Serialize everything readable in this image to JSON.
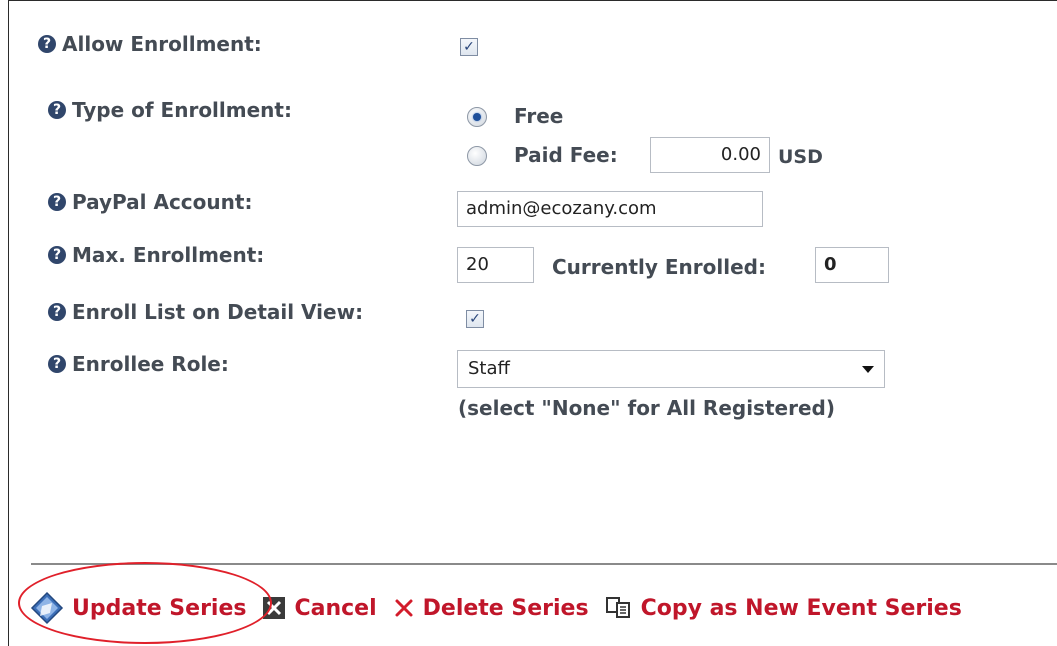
{
  "form": {
    "allow_enrollment": {
      "label": "Allow Enrollment:",
      "checked": true
    },
    "type_of_enrollment": {
      "label": "Type of Enrollment:",
      "options": [
        {
          "label": "Free",
          "selected": true
        },
        {
          "label": "Paid Fee:",
          "selected": false
        }
      ],
      "paid_fee_value": "0.00",
      "currency": "USD"
    },
    "paypal_account": {
      "label": "PayPal Account:",
      "value": "admin@ecozany.com"
    },
    "max_enrollment": {
      "label": "Max. Enrollment:",
      "value": "20",
      "currently_enrolled_label": "Currently Enrolled:",
      "currently_enrolled_value": "0"
    },
    "enroll_list_detail_view": {
      "label": "Enroll List on Detail View:",
      "checked": true
    },
    "enrollee_role": {
      "label": "Enrollee Role:",
      "selected": "Staff",
      "hint": "(select \"None\" for All Registered)"
    }
  },
  "actions": {
    "update": "Update Series",
    "cancel": "Cancel",
    "delete": "Delete Series",
    "copy": "Copy as New Event Series"
  },
  "colors": {
    "action_text": "#c0162a",
    "label_text": "#444b54",
    "help_icon": "#30466b",
    "highlight_circle": "#e0202a"
  },
  "icons": {
    "help": "question-circle-icon",
    "update": "diamond-save-icon",
    "cancel": "cancel-box-icon",
    "delete": "red-x-icon",
    "copy": "copy-documents-icon"
  }
}
